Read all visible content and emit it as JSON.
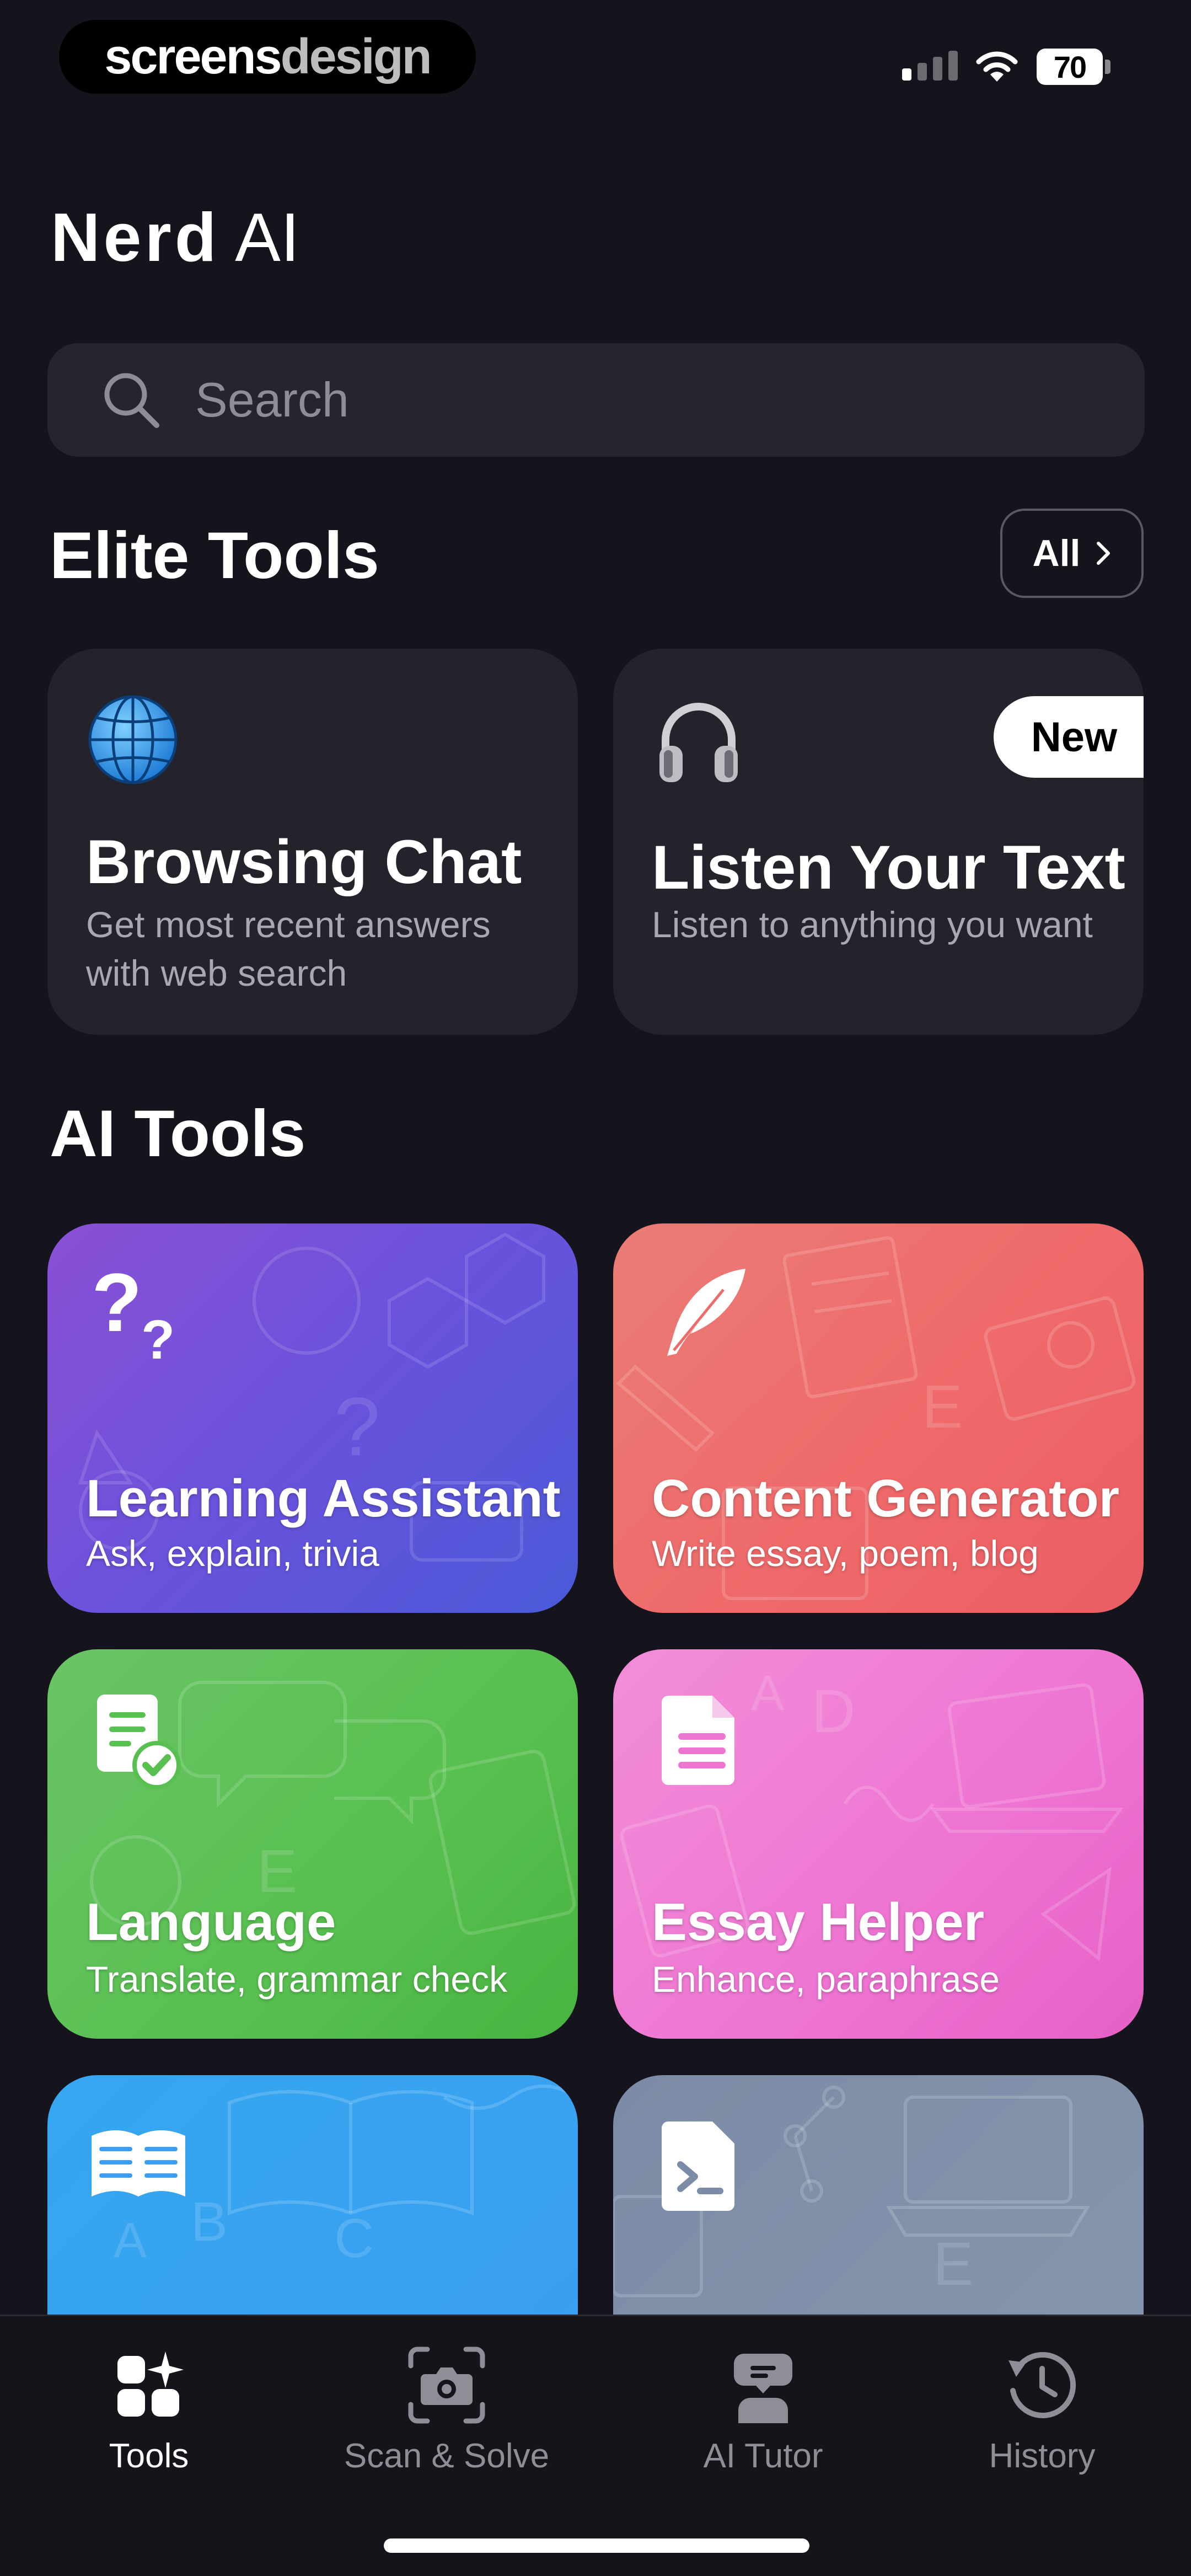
{
  "status_bar": {
    "watermark_part1": "screens",
    "watermark_part2": "design",
    "battery": "70"
  },
  "header": {
    "title_bold": "Nerd",
    "title_light": "AI"
  },
  "search": {
    "placeholder": "Search"
  },
  "elite_tools": {
    "title": "Elite Tools",
    "all_label": "All",
    "cards": [
      {
        "title": "Browsing Chat",
        "subtitle": "Get most recent answers with web search",
        "icon": "globe-icon"
      },
      {
        "title": "Listen Your Text",
        "subtitle": "Listen to anything you want",
        "icon": "headphones-icon",
        "badge": "New"
      }
    ]
  },
  "ai_tools": {
    "title": "AI Tools",
    "cards": [
      {
        "title": "Learning Assistant",
        "subtitle": "Ask, explain, trivia",
        "icon": "question-marks-icon",
        "color": "#6a52dc"
      },
      {
        "title": "Content Generator",
        "subtitle": "Write essay, poem, blog",
        "icon": "feather-icon",
        "color": "#ef6a6a"
      },
      {
        "title": "Language",
        "subtitle": "Translate, grammar check",
        "icon": "document-check-icon",
        "color": "#58c050"
      },
      {
        "title": "Essay Helper",
        "subtitle": "Enhance, paraphrase",
        "icon": "document-icon",
        "color": "#ee74d2"
      },
      {
        "title": "",
        "subtitle": "",
        "icon": "open-book-icon",
        "color": "#3a9ff0"
      },
      {
        "title": "",
        "subtitle": "",
        "icon": "terminal-file-icon",
        "color": "#8696ae"
      }
    ]
  },
  "tab_bar": {
    "tabs": [
      {
        "label": "Tools",
        "icon": "tools-grid-icon",
        "active": true
      },
      {
        "label": "Scan & Solve",
        "icon": "camera-scan-icon",
        "active": false
      },
      {
        "label": "AI Tutor",
        "icon": "tutor-icon",
        "active": false
      },
      {
        "label": "History",
        "icon": "history-icon",
        "active": false
      }
    ]
  }
}
